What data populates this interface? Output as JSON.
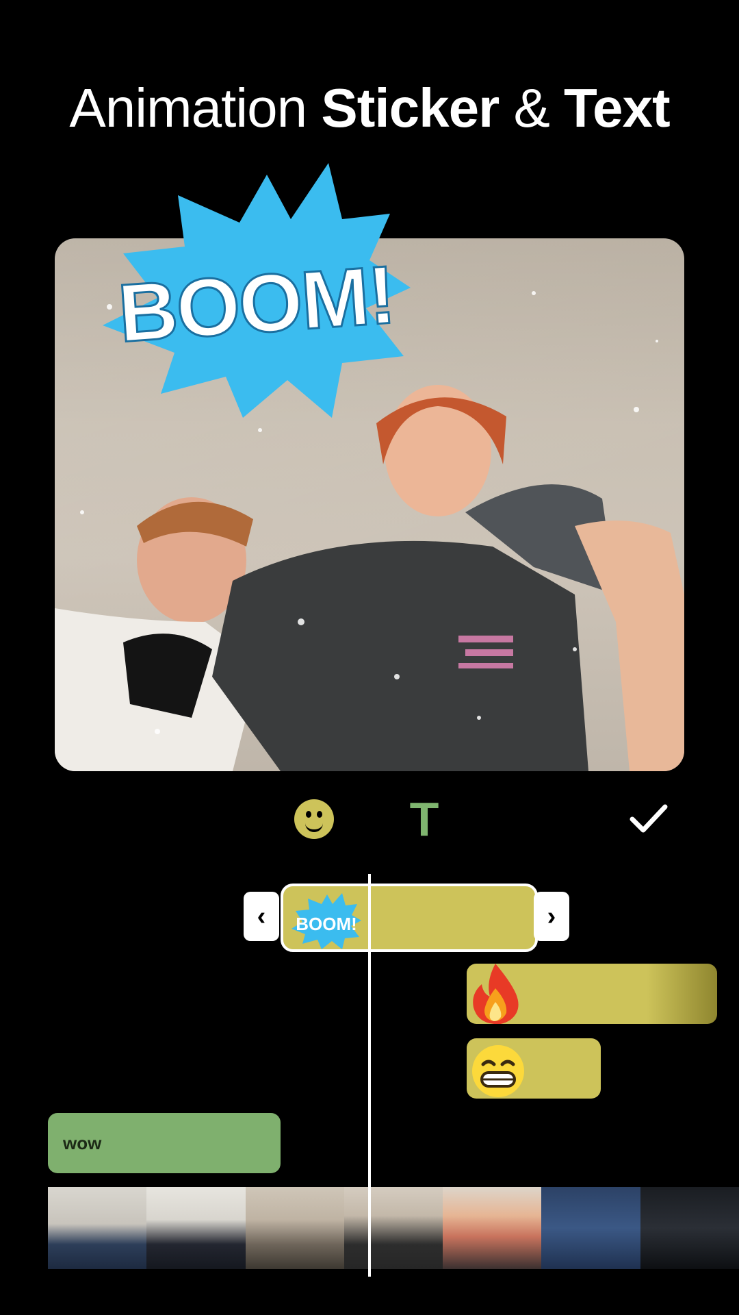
{
  "headline": {
    "part1": "Animation",
    "part2": "Sticker",
    "part3": "&",
    "part4": "Text"
  },
  "preview": {
    "sticker_text": "BOOM!",
    "sticker_color": "#3bbcef"
  },
  "toolbar": {
    "text_tool_label": "T",
    "icons": [
      "emoji-icon",
      "text-icon",
      "checkmark-icon"
    ],
    "sticker_tool_color": "#cdc35a",
    "text_tool_color": "#7fb56f"
  },
  "timeline": {
    "handle_left": "‹",
    "handle_right": "›",
    "boom_track_label": "BOOM!",
    "wow_label": "wow",
    "sticker_track_color": "#cdc35a",
    "text_track_color": "#7fb06e",
    "stickers": [
      "boom-sticker",
      "fire-emoji",
      "grinning-emoji"
    ]
  }
}
